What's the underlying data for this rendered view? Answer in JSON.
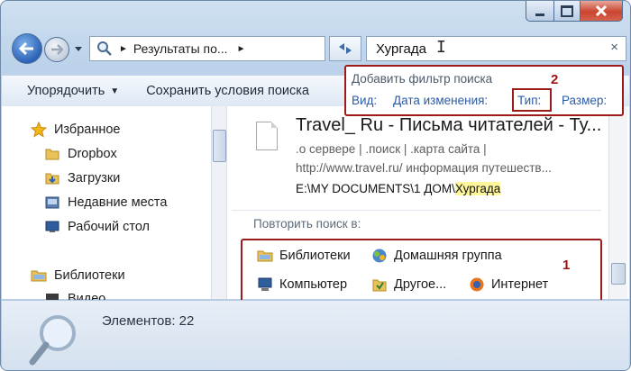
{
  "window": {
    "caption_buttons": [
      "minimize-icon",
      "maximize-icon",
      "close-icon"
    ]
  },
  "nav": {
    "breadcrumb": "Результаты по...",
    "search_value": "Хургада",
    "clear_icon": "×"
  },
  "toolbar": {
    "organize_label": "Упорядочить",
    "save_search_label": "Сохранить условия поиска"
  },
  "sidebar": {
    "items": [
      {
        "label": "Избранное",
        "icon": "star-icon"
      },
      {
        "label": "Dropbox",
        "icon": "folder-icon"
      },
      {
        "label": "Загрузки",
        "icon": "downloads-icon"
      },
      {
        "label": "Недавние места",
        "icon": "recent-places-icon"
      },
      {
        "label": "Рабочий стол",
        "icon": "desktop-icon"
      },
      {
        "label": "Библиотеки",
        "icon": "libraries-icon"
      },
      {
        "label": "Видео",
        "icon": "video-icon"
      }
    ]
  },
  "result": {
    "title": "Travel_ Ru - Письма читателей - Ту...",
    "snippet_1": ".о сервере | .поиск | .карта сайта |",
    "snippet_2": "http://www.travel.ru/ информация путешеств...",
    "path_prefix": "E:\\MY DOCUMENTS\\1 ДОМ\\",
    "path_highlight": "Хургада"
  },
  "repeat": {
    "label": "Повторить поиск в:",
    "links": [
      {
        "label": "Библиотеки",
        "icon": "libraries-icon"
      },
      {
        "label": "Домашняя группа",
        "icon": "homegroup-icon"
      },
      {
        "label": "Компьютер",
        "icon": "computer-icon"
      },
      {
        "label": "Другое...",
        "icon": "custom-folder-icon"
      },
      {
        "label": "Интернет",
        "icon": "internet-icon"
      }
    ]
  },
  "filter_popup": {
    "title": "Добавить фильтр поиска",
    "options": [
      "Вид:",
      "Дата изменения:",
      "Тип:",
      "Размер:"
    ]
  },
  "annotations": {
    "label_1": "1",
    "label_2": "2",
    "color": "#9b1b1b"
  },
  "status": {
    "count_text": "Элементов: 22"
  }
}
